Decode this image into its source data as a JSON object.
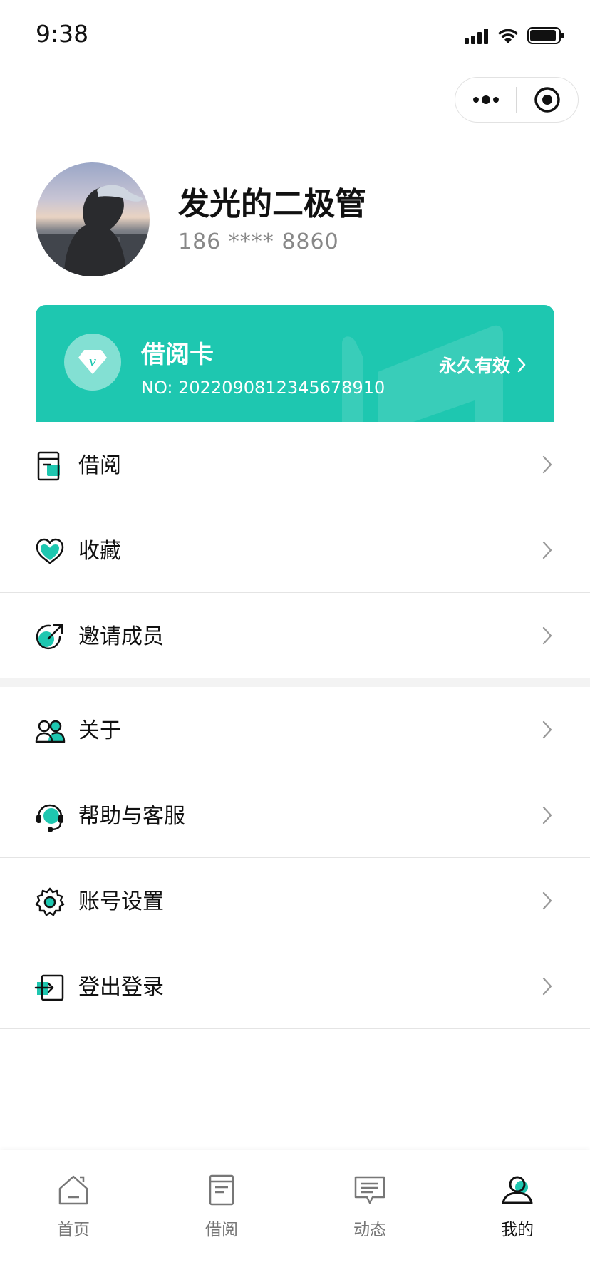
{
  "status_bar": {
    "time": "9:38"
  },
  "profile": {
    "name": "发光的二极管",
    "phone": "186 **** 8860"
  },
  "card": {
    "title": "借阅卡",
    "number": "NO: 2022090812345678910",
    "validity": "永久有效",
    "gem_letter": "v",
    "color": "#1ec7b0"
  },
  "menu": {
    "group1": [
      {
        "label": "借阅",
        "icon": "book-icon"
      },
      {
        "label": "收藏",
        "icon": "heart-icon"
      },
      {
        "label": "邀请成员",
        "icon": "share-icon"
      }
    ],
    "group2": [
      {
        "label": "关于",
        "icon": "people-icon"
      },
      {
        "label": "帮助与客服",
        "icon": "headset-icon"
      },
      {
        "label": "账号设置",
        "icon": "gear-icon"
      },
      {
        "label": "登出登录",
        "icon": "logout-icon"
      }
    ]
  },
  "tabbar": [
    {
      "label": "首页",
      "icon": "home-icon",
      "active": false
    },
    {
      "label": "借阅",
      "icon": "book-icon",
      "active": false
    },
    {
      "label": "动态",
      "icon": "message-icon",
      "active": false
    },
    {
      "label": "我的",
      "icon": "user-icon",
      "active": true
    }
  ],
  "colors": {
    "accent": "#1ec7b0",
    "text": "#111111",
    "muted": "#888888"
  }
}
